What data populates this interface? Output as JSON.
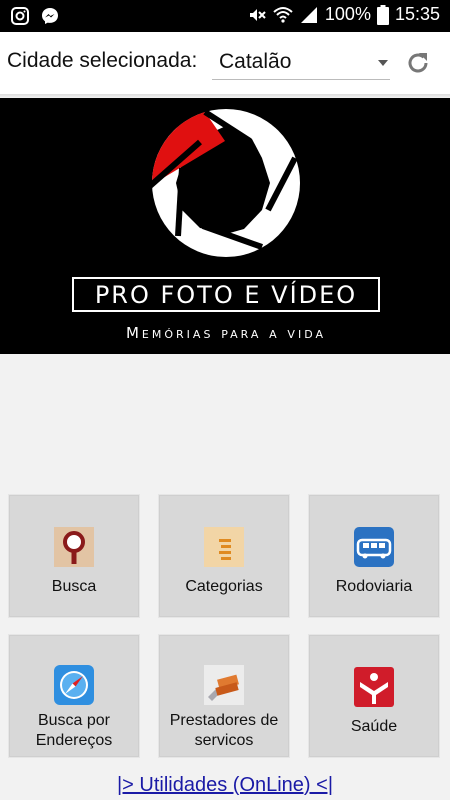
{
  "status_bar": {
    "battery": "100%",
    "time": "15:35",
    "icons": [
      "instagram-icon",
      "messenger-icon",
      "mute-icon",
      "wifi-icon",
      "signal-icon",
      "battery-icon"
    ]
  },
  "city": {
    "label": "Cidade selecionada:",
    "selected": "Catalão"
  },
  "banner": {
    "title": "PRO FOTO E VÍDEO",
    "subtitle": "Memórias para a vida"
  },
  "menu": {
    "items": [
      {
        "label": "Busca",
        "icon": "magnifier-icon"
      },
      {
        "label": "Categorias",
        "icon": "list-icon"
      },
      {
        "label": "Rodoviaria",
        "icon": "bus-icon"
      },
      {
        "label": "Busca por Endereços",
        "icon": "compass-icon"
      },
      {
        "label": "Prestadores de servicos",
        "icon": "tools-icon"
      },
      {
        "label": "Saúde",
        "icon": "health-icon"
      }
    ]
  },
  "footer": {
    "link": "|> Utilidades (OnLine) <|"
  },
  "colors": {
    "accent_red": "#e01010",
    "link_blue": "#1a1aa6",
    "tile_bg": "#d8d8d8"
  }
}
